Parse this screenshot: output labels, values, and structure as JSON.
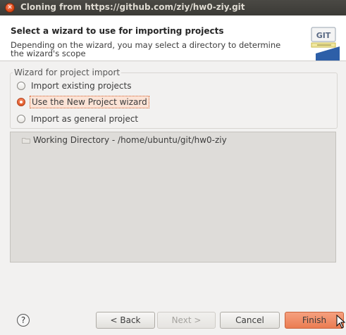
{
  "window": {
    "title": "Cloning from https://github.com/ziy/hw0-ziy.git"
  },
  "header": {
    "title": "Select a wizard to use for importing projects",
    "description": "Depending on the wizard, you may select a directory to determine the wizard's scope",
    "logo_text": "GIT"
  },
  "wizard_group": {
    "legend": "Wizard for project import",
    "options": [
      {
        "label": "Import existing projects",
        "checked": false
      },
      {
        "label": "Use the New Project wizard",
        "checked": true
      },
      {
        "label": "Import as general project",
        "checked": false
      }
    ]
  },
  "directory_tree": {
    "item": "Working Directory - /home/ubuntu/git/hw0-ziy"
  },
  "buttons": {
    "help": "?",
    "back": "< Back",
    "next": "Next >",
    "cancel": "Cancel",
    "finish": "Finish"
  },
  "colors": {
    "accent": "#eb7d52",
    "titlebar": "#3b3a36",
    "background": "#f2f1f0"
  }
}
